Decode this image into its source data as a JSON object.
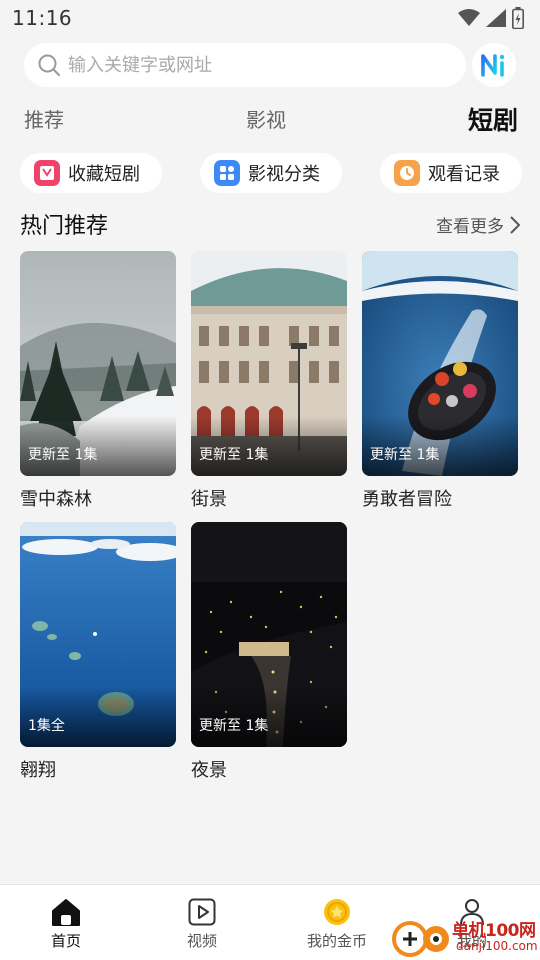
{
  "status": {
    "time": "11:16"
  },
  "search": {
    "placeholder": "输入关键字或网址",
    "ai_label": "Ai"
  },
  "tabs": [
    {
      "label": "推荐",
      "active": false
    },
    {
      "label": "影视",
      "active": false
    },
    {
      "label": "短剧",
      "active": true
    }
  ],
  "quick_links": [
    {
      "label": "收藏短剧",
      "icon": "favorite-dramas-icon",
      "color": "#f0436a"
    },
    {
      "label": "影视分类",
      "icon": "category-grid-icon",
      "color": "#3d8af7"
    },
    {
      "label": "观看记录",
      "icon": "history-clock-icon",
      "color": "#f7a24a"
    }
  ],
  "section": {
    "title": "热门推荐",
    "more_label": "查看更多"
  },
  "cards": [
    {
      "title": "雪中森林",
      "badge": "更新至 1集"
    },
    {
      "title": "街景",
      "badge": "更新至 1集"
    },
    {
      "title": "勇敢者冒险",
      "badge": "更新至 1集"
    },
    {
      "title": "翱翔",
      "badge": "1集全"
    },
    {
      "title": "夜景",
      "badge": "更新至 1集"
    }
  ],
  "bottom_nav": [
    {
      "label": "首页",
      "icon": "home-icon",
      "active": true
    },
    {
      "label": "视频",
      "icon": "video-play-icon",
      "active": false
    },
    {
      "label": "我的金币",
      "icon": "gold-coin-icon",
      "active": false
    },
    {
      "label": "我的",
      "icon": "profile-icon",
      "active": false
    }
  ],
  "watermark": {
    "text": "单机100网",
    "sub": "danji100.com"
  }
}
